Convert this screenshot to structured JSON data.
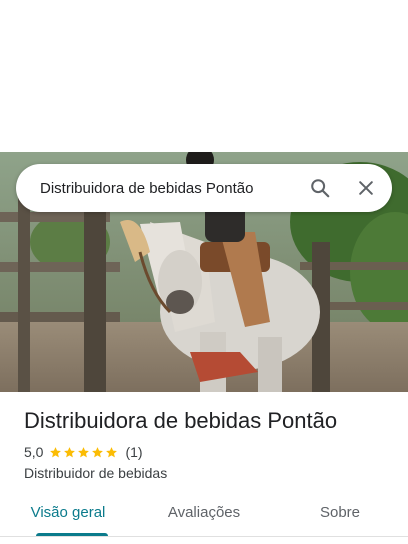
{
  "search": {
    "query": "Distribuidora de bebidas Pontão"
  },
  "place": {
    "name": "Distribuidora de bebidas Pontão",
    "rating": "5,0",
    "stars": 5,
    "review_count": "(1)",
    "category": "Distribuidor de bebidas"
  },
  "tabs": [
    {
      "label": "Visão geral",
      "active": true
    },
    {
      "label": "Avaliações",
      "active": false
    },
    {
      "label": "Sobre",
      "active": false
    }
  ],
  "colors": {
    "accent": "#0b7b8c",
    "star": "#fbbc04"
  },
  "icons": [
    "search-icon",
    "close-icon",
    "star-icon"
  ]
}
